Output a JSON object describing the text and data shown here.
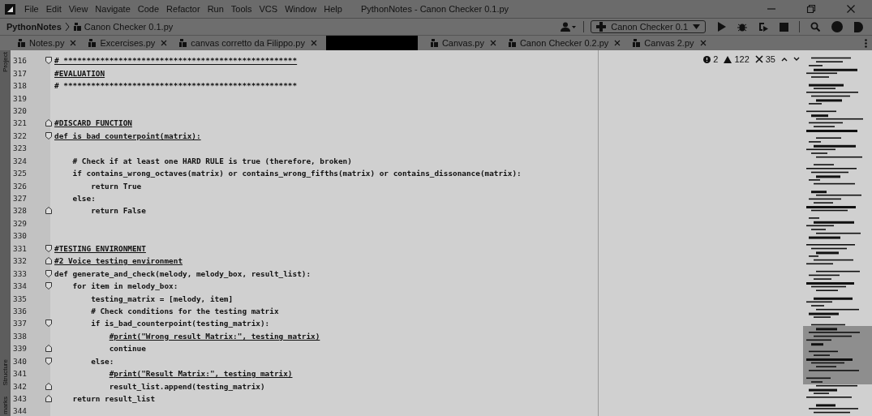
{
  "menu": [
    "File",
    "Edit",
    "View",
    "Navigate",
    "Code",
    "Refactor",
    "Run",
    "Tools",
    "VCS",
    "Window",
    "Help"
  ],
  "window": {
    "title": "PythonNotes - Canon Checker 0.1.py"
  },
  "breadcrumb": {
    "project": "PythonNotes",
    "file": "Canon Checker 0.1.py"
  },
  "run_config": {
    "label": "Canon Checker 0.1"
  },
  "tabs": [
    {
      "kind": "file",
      "label": "Notes.py",
      "selected": false
    },
    {
      "kind": "file",
      "label": "Excercises.py",
      "selected": false
    },
    {
      "kind": "file",
      "label": "canvas corretto da Filippo.py",
      "selected": false
    },
    {
      "kind": "redacted"
    },
    {
      "kind": "file",
      "label": "Canvas.py",
      "selected": false
    },
    {
      "kind": "file",
      "label": "Canon Checker 0.2.py",
      "selected": false
    },
    {
      "kind": "file",
      "label": "Canvas 2.py",
      "selected": false
    }
  ],
  "side_tools": {
    "top": "Project",
    "bottom": [
      "Structure",
      "marks"
    ]
  },
  "inspections": {
    "errors": "2",
    "warnings": "122",
    "typos": "35"
  },
  "code": [
    {
      "number": "316",
      "text": "# ***************************************************",
      "underlined": true,
      "kind": "fold_start"
    },
    {
      "number": "317",
      "text": "#EVALUATION",
      "underlined": true,
      "kind": "plain"
    },
    {
      "number": "318",
      "text": "# ***************************************************",
      "underlined": false,
      "kind": "plain"
    },
    {
      "number": "319",
      "kind": "plain"
    },
    {
      "number": "320",
      "kind": "plain"
    },
    {
      "number": "321",
      "text": "#DISCARD FUNCTION",
      "underlined": true,
      "kind": "fold_end"
    },
    {
      "number": "322",
      "text": "def is_bad_counterpoint(matrix):",
      "underlined": true,
      "kind": "fold_start"
    },
    {
      "number": "323",
      "kind": "plain"
    },
    {
      "number": "324",
      "text": "    # Check if at least one HARD RULE is true (therefore, broken)",
      "underlined": false,
      "kind": "plain"
    },
    {
      "number": "325",
      "text": "    if contains_wrong_octaves(matrix) or contains_wrong_fifths(matrix) or contains_dissonance(matrix):",
      "underlined": false,
      "kind": "plain"
    },
    {
      "number": "326",
      "text": "        return True",
      "underlined": false,
      "kind": "plain"
    },
    {
      "number": "327",
      "text": "    else:",
      "underlined": false,
      "kind": "plain"
    },
    {
      "number": "328",
      "text": "        return False",
      "underlined": false,
      "kind": "fold_end"
    },
    {
      "number": "329",
      "kind": "plain"
    },
    {
      "number": "330",
      "kind": "plain"
    },
    {
      "number": "331",
      "text": "#TESTING ENVIRONMENT",
      "underlined": true,
      "kind": "fold_start"
    },
    {
      "number": "332",
      "text": "#2 Voice testing environment",
      "underlined": true,
      "kind": "fold_end"
    },
    {
      "number": "333",
      "text": "def generate_and_check(melody, melody_box, result_list):",
      "underlined": false,
      "kind": "fold_start"
    },
    {
      "number": "334",
      "text": "    for item in melody_box:",
      "underlined": false,
      "kind": "fold_start"
    },
    {
      "number": "335",
      "text": "        testing_matrix = [melody, item]",
      "underlined": false,
      "kind": "plain"
    },
    {
      "number": "336",
      "text": "        # Check conditions for the testing matrix",
      "underlined": false,
      "kind": "plain"
    },
    {
      "number": "337",
      "text": "        if is_bad_counterpoint(testing_matrix):",
      "underlined": false,
      "kind": "fold_start"
    },
    {
      "number": "338",
      "text": "            #print(\"Wrong result Matrix:\", testing_matrix)",
      "underlined": true,
      "kind": "plain"
    },
    {
      "number": "339",
      "text": "            continue",
      "underlined": false,
      "kind": "fold_end"
    },
    {
      "number": "340",
      "text": "        else:",
      "underlined": false,
      "kind": "fold_start"
    },
    {
      "number": "341",
      "text": "            #print(\"Result Matrix:\", testing_matrix)",
      "underlined": true,
      "kind": "plain"
    },
    {
      "number": "342",
      "text": "            result_list.append(testing_matrix)",
      "underlined": false,
      "kind": "fold_end"
    },
    {
      "number": "343",
      "text": "    return result_list",
      "underlined": false,
      "kind": "fold_end"
    },
    {
      "number": "344",
      "kind": "plain"
    }
  ]
}
